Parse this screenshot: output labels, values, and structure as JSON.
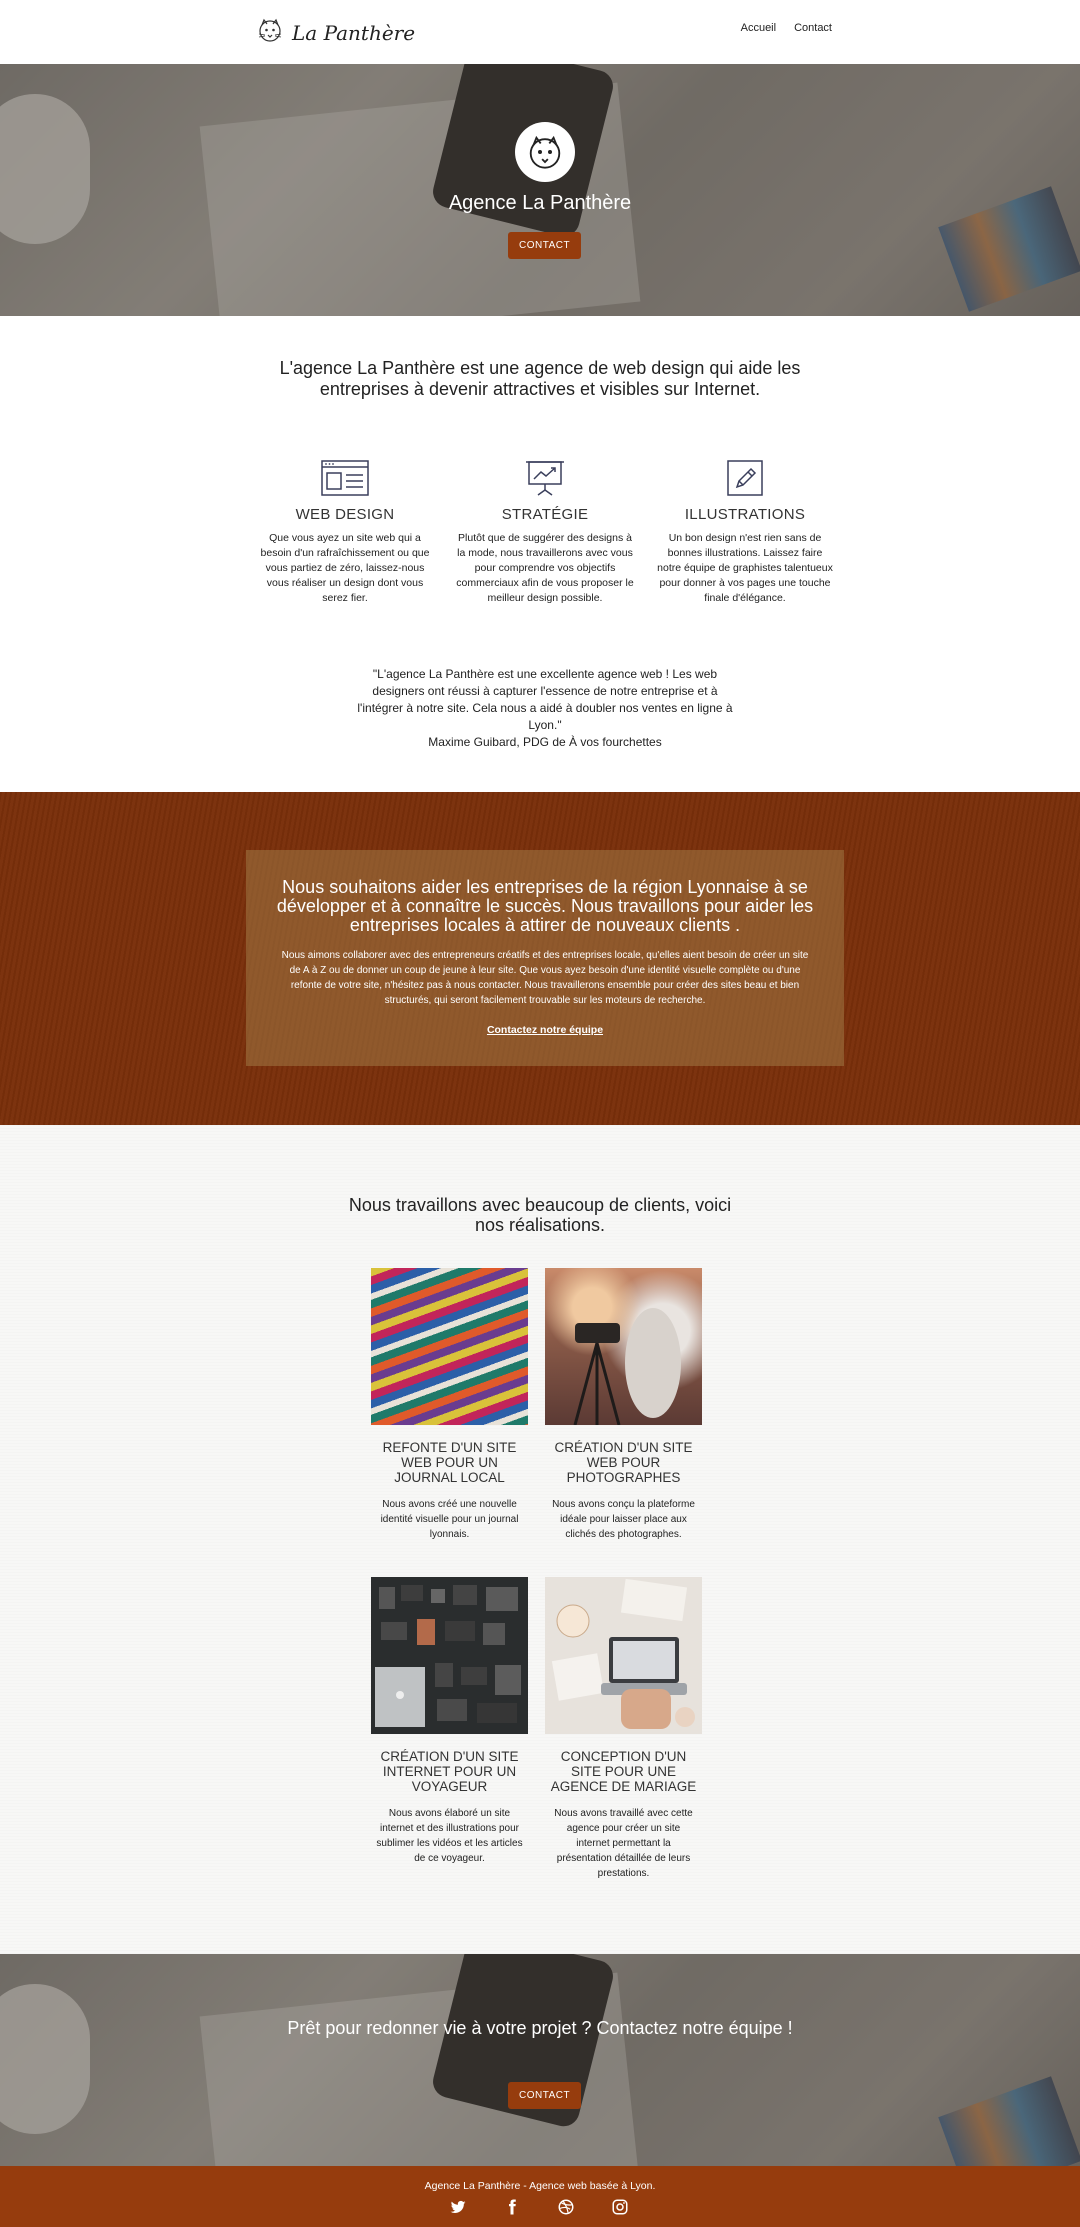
{
  "header": {
    "brand": "La Panthère",
    "nav": {
      "home": "Accueil",
      "contact": "Contact"
    }
  },
  "hero": {
    "title": "Agence La Panthère",
    "button": "CONTACT"
  },
  "intro": "L'agence La Panthère est une agence de web design qui aide les entreprises à devenir attractives et visibles sur Internet.",
  "services": [
    {
      "icon": "browser-layout-icon",
      "title": "WEB DESIGN",
      "text": "Que vous ayez un site web qui a besoin d'un rafraîchissement ou que vous partiez de zéro, laissez-nous vous réaliser un design dont vous serez fier."
    },
    {
      "icon": "presentation-chart-icon",
      "title": "STRATÉGIE",
      "text": "Plutôt que de suggérer des designs à la mode, nous travaillerons avec vous pour comprendre vos objectifs commerciaux afin de vous proposer le meilleur design possible."
    },
    {
      "icon": "pencil-icon",
      "title": "ILLUSTRATIONS",
      "text": "Un bon design n'est rien sans de bonnes illustrations. Laissez faire notre équipe de graphistes talentueux pour donner à vos pages une touche finale d'élégance."
    }
  ],
  "testimonial": {
    "quote": "\"L'agence La Panthère est une excellente agence web ! Les web designers ont réussi à capturer l'essence de notre entreprise et à l'intégrer à notre site. Cela nous a aidé à doubler nos ventes en ligne à Lyon.\"",
    "author": "Maxime Guibard, PDG de À vos fourchettes"
  },
  "mission": {
    "title": "Nous souhaitons aider les entreprises de la région Lyonnaise à se développer et à connaître le succès. Nous travaillons pour aider les entreprises locales à attirer de nouveaux clients .",
    "text": "Nous aimons collaborer avec des entrepreneurs créatifs et des entreprises locale, qu'elles aient besoin de créer un site de A à Z ou de donner un coup de jeune à leur site. Que vous ayez besoin d'une identité visuelle complète ou d'une refonte de votre site, n'hésitez pas à nous contacter. Nous travaillerons ensemble pour créer des sites beau et bien structurés, qui seront facilement trouvable sur les moteurs de recherche.",
    "link": "Contactez notre équipe"
  },
  "portfolio": {
    "title": "Nous travaillons avec beaucoup de clients, voici nos réalisations.",
    "projects": [
      {
        "title": "REFONTE D'UN SITE WEB POUR UN JOURNAL LOCAL",
        "text": "Nous avons créé une nouvelle identité visuelle pour un journal lyonnais."
      },
      {
        "title": "CRÉATION D'UN SITE WEB POUR PHOTOGRAPHES",
        "text": "Nous avons conçu la plateforme idéale pour laisser place aux clichés des photographes."
      },
      {
        "title": "CRÉATION D'UN SITE INTERNET POUR UN VOYAGEUR",
        "text": "Nous avons élaboré un site internet et des illustrations pour sublimer les vidéos et les articles de ce voyageur."
      },
      {
        "title": "CONCEPTION D'UN SITE POUR UNE AGENCE DE MARIAGE",
        "text": "Nous avons travaillé avec cette agence pour créer un site internet permettant la présentation détaillée de leurs prestations."
      }
    ]
  },
  "cta": {
    "title": "Prêt pour redonner vie à votre projet ? Contactez notre équipe !",
    "button": "CONTACT"
  },
  "footer": {
    "text": "Agence La Panthère - Agence web basée à Lyon.",
    "social": [
      "twitter-icon",
      "facebook-icon",
      "dribbble-icon",
      "instagram-icon"
    ]
  },
  "colors": {
    "accent": "#963c0d",
    "mission_bg": "#7a2f0a"
  }
}
